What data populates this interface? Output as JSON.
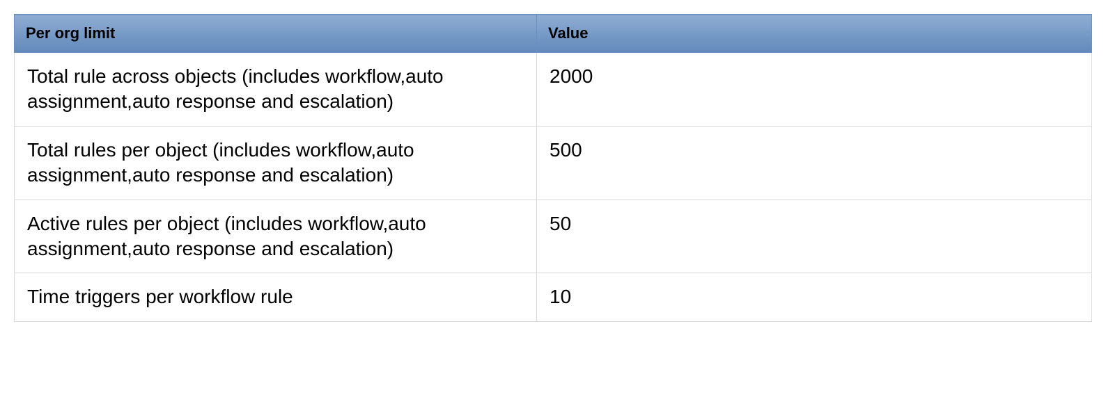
{
  "table": {
    "headers": {
      "limit": "Per org limit",
      "value": "Value"
    },
    "rows": [
      {
        "limit": "Total rule across objects (includes workflow,auto assignment,auto response and escalation)",
        "value": "2000"
      },
      {
        "limit": "Total rules per object  (includes workflow,auto assignment,auto response and escalation)",
        "value": "500"
      },
      {
        "limit": "Active rules per object (includes workflow,auto assignment,auto response and escalation)",
        "value": "50"
      },
      {
        "limit": "Time triggers per workflow rule",
        "value": "10"
      }
    ]
  }
}
